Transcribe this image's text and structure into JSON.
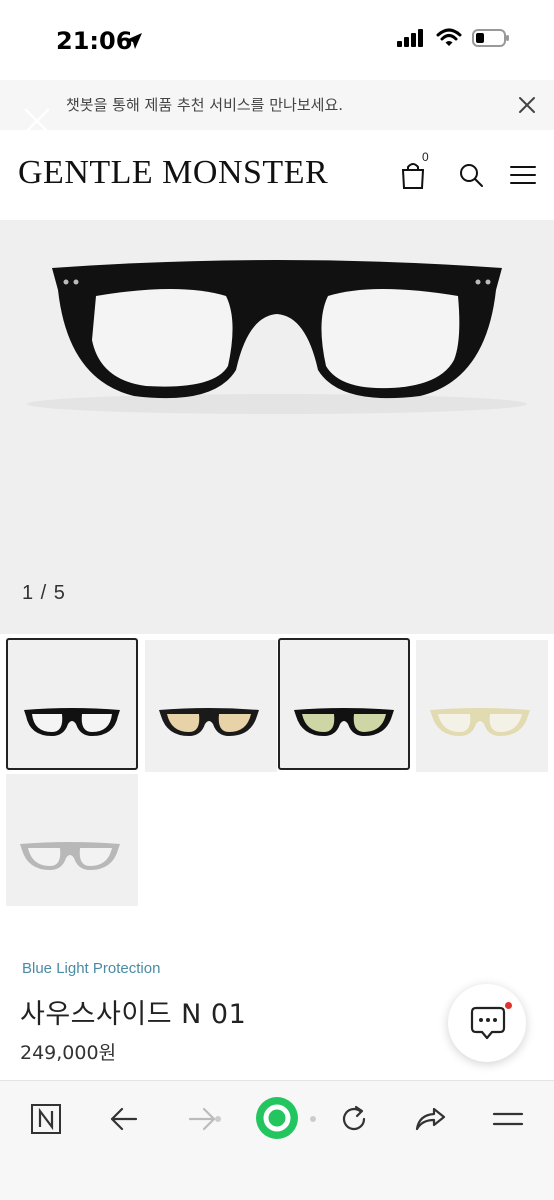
{
  "status": {
    "time": "21:06"
  },
  "banner": {
    "text": "챗봇을 통해 제품 추천 서비스를 만나보세요."
  },
  "header": {
    "logo": "GENTLE MONSTER",
    "cart_count": "0"
  },
  "hero": {
    "counter": "1 / 5"
  },
  "thumbnails": [
    {
      "name": "black",
      "lens": "#f4f4f4",
      "frame": "#111111",
      "selected": true
    },
    {
      "name": "brown-tint",
      "lens": "#e8d2a8",
      "frame": "#1a1a1a",
      "selected": false
    },
    {
      "name": "green-tint",
      "lens": "#cdd6a4",
      "frame": "#111111",
      "selected": true
    },
    {
      "name": "clear-yellow",
      "lens": "#f4f2e6",
      "frame": "#e2dbb2",
      "selected": false
    },
    {
      "name": "clear-grey",
      "lens": "#f2f2f2",
      "frame": "#b8b8b8",
      "selected": false
    }
  ],
  "product": {
    "category": "Blue Light Protection",
    "name": "사우스사이드 N 01",
    "price": "249,000원"
  },
  "colors": {
    "accent_category": "#4a8ba5",
    "chat_badge": "#e0322f",
    "green_button": "#22c55e"
  },
  "icons": {
    "cart": "shopping-bag-icon",
    "search": "search-icon",
    "menu": "hamburger-icon",
    "chat": "chat-bubble-icon"
  }
}
